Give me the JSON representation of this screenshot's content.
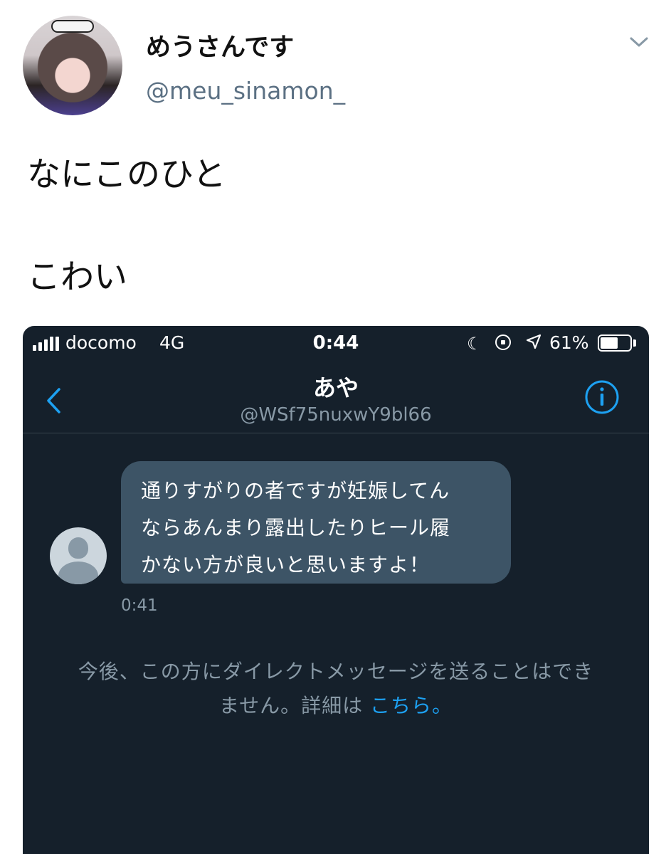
{
  "tweet": {
    "display_name": "めうさんです",
    "handle": "@meu_sinamon_",
    "text_line_1": "なにこのひと",
    "text_line_2": "こわい"
  },
  "embedded_screenshot": {
    "status_bar": {
      "carrier": "docomo",
      "network": "4G",
      "time": "0:44",
      "battery_percent": "61%",
      "battery_level": 0.61
    },
    "dm_header": {
      "name": "あや",
      "handle": "@WSf75nuxwY9bl66"
    },
    "message": {
      "lines": [
        "通りすがりの者ですが妊娠してん",
        "ならあんまり露出したりヒール履",
        "かない方が良いと思いますよ！"
      ],
      "time": "0:41"
    },
    "notice": {
      "line_1": "今後、この方にダイレクトメッセージを送ることはでき",
      "line_2": "ません。詳細は ",
      "link": "こちら。"
    }
  },
  "colors": {
    "dark_bg": "#15202b",
    "bubble": "#3d5466",
    "accent": "#1da1f2",
    "secondary_text": "#8899a6"
  },
  "icons": [
    "chevron-down-icon",
    "signal-icon",
    "moon-icon",
    "rotation-lock-icon",
    "location-arrow-icon",
    "battery-icon",
    "back-chevron-icon",
    "info-icon",
    "default-avatar-icon"
  ]
}
